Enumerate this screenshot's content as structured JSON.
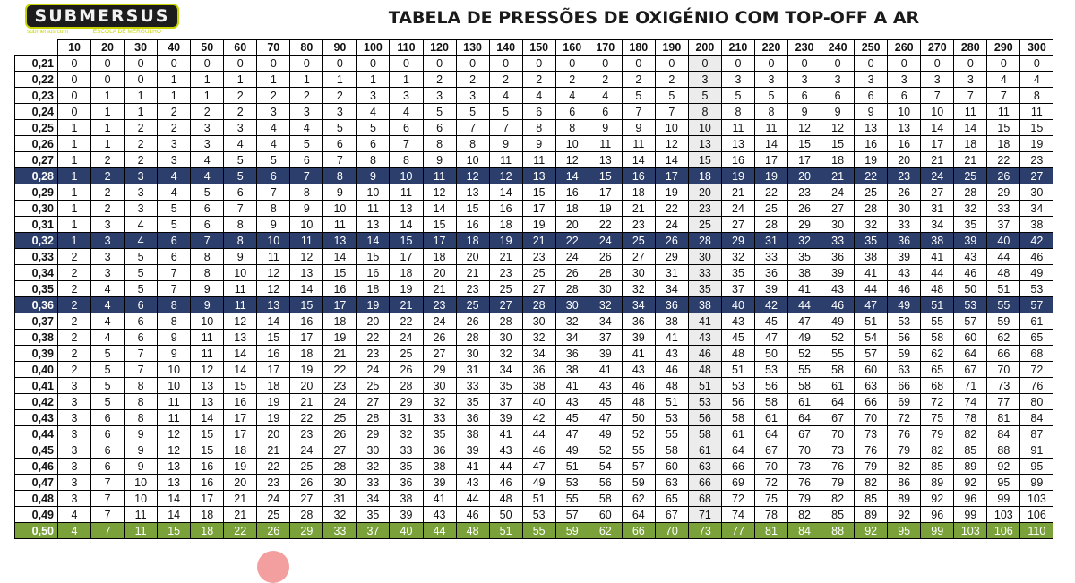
{
  "header": {
    "logo_text": "SUBMERSUS",
    "logo_sub_left": "submersus.com",
    "logo_sub_right": "ESCOLA DE MERGULHO",
    "title": "TABELA DE PRESSÕES DE OXIGÉNIO COM TOP-OFF A AR"
  },
  "colors": {
    "blue_row": "#2c3e6b",
    "green_row": "#7ba23a",
    "logo_bg": "#1c1c1c",
    "logo_accent": "#c8d400"
  },
  "table": {
    "columns": [
      "10",
      "20",
      "30",
      "40",
      "50",
      "60",
      "70",
      "80",
      "90",
      "100",
      "110",
      "120",
      "130",
      "140",
      "150",
      "160",
      "170",
      "180",
      "190",
      "200",
      "210",
      "220",
      "230",
      "240",
      "250",
      "260",
      "270",
      "280",
      "290",
      "300"
    ],
    "highlight_column": "200",
    "rows": [
      {
        "label": "0,21",
        "style": "",
        "values": [
          "0",
          "0",
          "0",
          "0",
          "0",
          "0",
          "0",
          "0",
          "0",
          "0",
          "0",
          "0",
          "0",
          "0",
          "0",
          "0",
          "0",
          "0",
          "0",
          "0",
          "0",
          "0",
          "0",
          "0",
          "0",
          "0",
          "0",
          "0",
          "0",
          "0"
        ]
      },
      {
        "label": "0,22",
        "style": "",
        "values": [
          "0",
          "0",
          "0",
          "1",
          "1",
          "1",
          "1",
          "1",
          "1",
          "1",
          "1",
          "2",
          "2",
          "2",
          "2",
          "2",
          "2",
          "2",
          "2",
          "3",
          "3",
          "3",
          "3",
          "3",
          "3",
          "3",
          "3",
          "3",
          "4",
          "4"
        ]
      },
      {
        "label": "0,23",
        "style": "",
        "values": [
          "0",
          "1",
          "1",
          "1",
          "1",
          "2",
          "2",
          "2",
          "2",
          "3",
          "3",
          "3",
          "3",
          "4",
          "4",
          "4",
          "4",
          "5",
          "5",
          "5",
          "5",
          "5",
          "6",
          "6",
          "6",
          "6",
          "7",
          "7",
          "7",
          "8"
        ]
      },
      {
        "label": "0,24",
        "style": "",
        "values": [
          "0",
          "1",
          "1",
          "2",
          "2",
          "2",
          "3",
          "3",
          "3",
          "4",
          "4",
          "5",
          "5",
          "5",
          "6",
          "6",
          "6",
          "7",
          "7",
          "8",
          "8",
          "8",
          "9",
          "9",
          "9",
          "10",
          "10",
          "11",
          "11",
          "11"
        ]
      },
      {
        "label": "0,25",
        "style": "",
        "values": [
          "1",
          "1",
          "2",
          "2",
          "3",
          "3",
          "4",
          "4",
          "5",
          "5",
          "6",
          "6",
          "7",
          "7",
          "8",
          "8",
          "9",
          "9",
          "10",
          "10",
          "11",
          "11",
          "12",
          "12",
          "13",
          "13",
          "14",
          "14",
          "15",
          "15"
        ]
      },
      {
        "label": "0,26",
        "style": "",
        "values": [
          "1",
          "1",
          "2",
          "3",
          "3",
          "4",
          "4",
          "5",
          "6",
          "6",
          "7",
          "8",
          "8",
          "9",
          "9",
          "10",
          "11",
          "11",
          "12",
          "13",
          "13",
          "14",
          "15",
          "15",
          "16",
          "16",
          "17",
          "18",
          "18",
          "19"
        ]
      },
      {
        "label": "0,27",
        "style": "",
        "values": [
          "1",
          "2",
          "2",
          "3",
          "4",
          "5",
          "5",
          "6",
          "7",
          "8",
          "8",
          "9",
          "10",
          "11",
          "11",
          "12",
          "13",
          "14",
          "14",
          "15",
          "16",
          "17",
          "17",
          "18",
          "19",
          "20",
          "21",
          "21",
          "22",
          "23"
        ]
      },
      {
        "label": "0,28",
        "style": "blue",
        "values": [
          "1",
          "2",
          "3",
          "4",
          "4",
          "5",
          "6",
          "7",
          "8",
          "9",
          "10",
          "11",
          "12",
          "12",
          "13",
          "14",
          "15",
          "16",
          "17",
          "18",
          "19",
          "19",
          "20",
          "21",
          "22",
          "23",
          "24",
          "25",
          "26",
          "27"
        ]
      },
      {
        "label": "0,29",
        "style": "",
        "values": [
          "1",
          "2",
          "3",
          "4",
          "5",
          "6",
          "7",
          "8",
          "9",
          "10",
          "11",
          "12",
          "13",
          "14",
          "15",
          "16",
          "17",
          "18",
          "19",
          "20",
          "21",
          "22",
          "23",
          "24",
          "25",
          "26",
          "27",
          "28",
          "29",
          "30"
        ]
      },
      {
        "label": "0,30",
        "style": "",
        "values": [
          "1",
          "2",
          "3",
          "5",
          "6",
          "7",
          "8",
          "9",
          "10",
          "11",
          "13",
          "14",
          "15",
          "16",
          "17",
          "18",
          "19",
          "21",
          "22",
          "23",
          "24",
          "25",
          "26",
          "27",
          "28",
          "30",
          "31",
          "32",
          "33",
          "34"
        ]
      },
      {
        "label": "0,31",
        "style": "",
        "values": [
          "1",
          "3",
          "4",
          "5",
          "6",
          "8",
          "9",
          "10",
          "11",
          "13",
          "14",
          "15",
          "16",
          "18",
          "19",
          "20",
          "22",
          "23",
          "24",
          "25",
          "27",
          "28",
          "29",
          "30",
          "32",
          "33",
          "34",
          "35",
          "37",
          "38"
        ]
      },
      {
        "label": "0,32",
        "style": "blue",
        "values": [
          "1",
          "3",
          "4",
          "6",
          "7",
          "8",
          "10",
          "11",
          "13",
          "14",
          "15",
          "17",
          "18",
          "19",
          "21",
          "22",
          "24",
          "25",
          "26",
          "28",
          "29",
          "31",
          "32",
          "33",
          "35",
          "36",
          "38",
          "39",
          "40",
          "42"
        ]
      },
      {
        "label": "0,33",
        "style": "",
        "values": [
          "2",
          "3",
          "5",
          "6",
          "8",
          "9",
          "11",
          "12",
          "14",
          "15",
          "17",
          "18",
          "20",
          "21",
          "23",
          "24",
          "26",
          "27",
          "29",
          "30",
          "32",
          "33",
          "35",
          "36",
          "38",
          "39",
          "41",
          "43",
          "44",
          "46"
        ]
      },
      {
        "label": "0,34",
        "style": "",
        "values": [
          "2",
          "3",
          "5",
          "7",
          "8",
          "10",
          "12",
          "13",
          "15",
          "16",
          "18",
          "20",
          "21",
          "23",
          "25",
          "26",
          "28",
          "30",
          "31",
          "33",
          "35",
          "36",
          "38",
          "39",
          "41",
          "43",
          "44",
          "46",
          "48",
          "49"
        ]
      },
      {
        "label": "0,35",
        "style": "",
        "values": [
          "2",
          "4",
          "5",
          "7",
          "9",
          "11",
          "12",
          "14",
          "16",
          "18",
          "19",
          "21",
          "23",
          "25",
          "27",
          "28",
          "30",
          "32",
          "34",
          "35",
          "37",
          "39",
          "41",
          "43",
          "44",
          "46",
          "48",
          "50",
          "51",
          "53"
        ]
      },
      {
        "label": "0,36",
        "style": "blue",
        "values": [
          "2",
          "4",
          "6",
          "8",
          "9",
          "11",
          "13",
          "15",
          "17",
          "19",
          "21",
          "23",
          "25",
          "27",
          "28",
          "30",
          "32",
          "34",
          "36",
          "38",
          "40",
          "42",
          "44",
          "46",
          "47",
          "49",
          "51",
          "53",
          "55",
          "57"
        ]
      },
      {
        "label": "0,37",
        "style": "",
        "values": [
          "2",
          "4",
          "6",
          "8",
          "10",
          "12",
          "14",
          "16",
          "18",
          "20",
          "22",
          "24",
          "26",
          "28",
          "30",
          "32",
          "34",
          "36",
          "38",
          "41",
          "43",
          "45",
          "47",
          "49",
          "51",
          "53",
          "55",
          "57",
          "59",
          "61"
        ]
      },
      {
        "label": "0,38",
        "style": "",
        "values": [
          "2",
          "4",
          "6",
          "9",
          "11",
          "13",
          "15",
          "17",
          "19",
          "22",
          "24",
          "26",
          "28",
          "30",
          "32",
          "34",
          "37",
          "39",
          "41",
          "43",
          "45",
          "47",
          "49",
          "52",
          "54",
          "56",
          "58",
          "60",
          "62",
          "65"
        ]
      },
      {
        "label": "0,39",
        "style": "",
        "values": [
          "2",
          "5",
          "7",
          "9",
          "11",
          "14",
          "16",
          "18",
          "21",
          "23",
          "25",
          "27",
          "30",
          "32",
          "34",
          "36",
          "39",
          "41",
          "43",
          "46",
          "48",
          "50",
          "52",
          "55",
          "57",
          "59",
          "62",
          "64",
          "66",
          "68"
        ]
      },
      {
        "label": "0,40",
        "style": "",
        "values": [
          "2",
          "5",
          "7",
          "10",
          "12",
          "14",
          "17",
          "19",
          "22",
          "24",
          "26",
          "29",
          "31",
          "34",
          "36",
          "38",
          "41",
          "43",
          "46",
          "48",
          "51",
          "53",
          "55",
          "58",
          "60",
          "63",
          "65",
          "67",
          "70",
          "72"
        ]
      },
      {
        "label": "0,41",
        "style": "",
        "values": [
          "3",
          "5",
          "8",
          "10",
          "13",
          "15",
          "18",
          "20",
          "23",
          "25",
          "28",
          "30",
          "33",
          "35",
          "38",
          "41",
          "43",
          "46",
          "48",
          "51",
          "53",
          "56",
          "58",
          "61",
          "63",
          "66",
          "68",
          "71",
          "73",
          "76"
        ]
      },
      {
        "label": "0,42",
        "style": "",
        "values": [
          "3",
          "5",
          "8",
          "11",
          "13",
          "16",
          "19",
          "21",
          "24",
          "27",
          "29",
          "32",
          "35",
          "37",
          "40",
          "43",
          "45",
          "48",
          "51",
          "53",
          "56",
          "58",
          "61",
          "64",
          "66",
          "69",
          "72",
          "74",
          "77",
          "80"
        ]
      },
      {
        "label": "0,43",
        "style": "",
        "values": [
          "3",
          "6",
          "8",
          "11",
          "14",
          "17",
          "19",
          "22",
          "25",
          "28",
          "31",
          "33",
          "36",
          "39",
          "42",
          "45",
          "47",
          "50",
          "53",
          "56",
          "58",
          "61",
          "64",
          "67",
          "70",
          "72",
          "75",
          "78",
          "81",
          "84"
        ]
      },
      {
        "label": "0,44",
        "style": "",
        "values": [
          "3",
          "6",
          "9",
          "12",
          "15",
          "17",
          "20",
          "23",
          "26",
          "29",
          "32",
          "35",
          "38",
          "41",
          "44",
          "47",
          "49",
          "52",
          "55",
          "58",
          "61",
          "64",
          "67",
          "70",
          "73",
          "76",
          "79",
          "82",
          "84",
          "87"
        ]
      },
      {
        "label": "0,45",
        "style": "",
        "values": [
          "3",
          "6",
          "9",
          "12",
          "15",
          "18",
          "21",
          "24",
          "27",
          "30",
          "33",
          "36",
          "39",
          "43",
          "46",
          "49",
          "52",
          "55",
          "58",
          "61",
          "64",
          "67",
          "70",
          "73",
          "76",
          "79",
          "82",
          "85",
          "88",
          "91"
        ]
      },
      {
        "label": "0,46",
        "style": "",
        "values": [
          "3",
          "6",
          "9",
          "13",
          "16",
          "19",
          "22",
          "25",
          "28",
          "32",
          "35",
          "38",
          "41",
          "44",
          "47",
          "51",
          "54",
          "57",
          "60",
          "63",
          "66",
          "70",
          "73",
          "76",
          "79",
          "82",
          "85",
          "89",
          "92",
          "95"
        ]
      },
      {
        "label": "0,47",
        "style": "",
        "values": [
          "3",
          "7",
          "10",
          "13",
          "16",
          "20",
          "23",
          "26",
          "30",
          "33",
          "36",
          "39",
          "43",
          "46",
          "49",
          "53",
          "56",
          "59",
          "63",
          "66",
          "69",
          "72",
          "76",
          "79",
          "82",
          "86",
          "89",
          "92",
          "95",
          "99"
        ]
      },
      {
        "label": "0,48",
        "style": "",
        "values": [
          "3",
          "7",
          "10",
          "14",
          "17",
          "21",
          "24",
          "27",
          "31",
          "34",
          "38",
          "41",
          "44",
          "48",
          "51",
          "55",
          "58",
          "62",
          "65",
          "68",
          "72",
          "75",
          "79",
          "82",
          "85",
          "89",
          "92",
          "96",
          "99",
          "103"
        ]
      },
      {
        "label": "0,49",
        "style": "",
        "values": [
          "4",
          "7",
          "11",
          "14",
          "18",
          "21",
          "25",
          "28",
          "32",
          "35",
          "39",
          "43",
          "46",
          "50",
          "53",
          "57",
          "60",
          "64",
          "67",
          "71",
          "74",
          "78",
          "82",
          "85",
          "89",
          "92",
          "96",
          "99",
          "103",
          "106"
        ]
      },
      {
        "label": "0,50",
        "style": "green",
        "values": [
          "4",
          "7",
          "11",
          "15",
          "18",
          "22",
          "26",
          "29",
          "33",
          "37",
          "40",
          "44",
          "48",
          "51",
          "55",
          "59",
          "62",
          "66",
          "70",
          "73",
          "77",
          "81",
          "84",
          "88",
          "92",
          "95",
          "99",
          "103",
          "106",
          "110"
        ]
      }
    ]
  }
}
